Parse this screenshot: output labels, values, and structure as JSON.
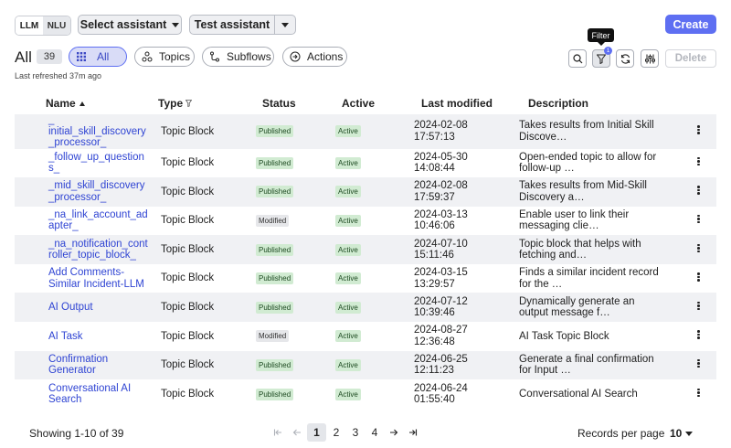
{
  "toolbar": {
    "seg_llm": "LLM",
    "seg_nlu": "NLU",
    "select_assistant": "Select assistant",
    "test_assistant": "Test assistant",
    "create": "Create"
  },
  "filters": {
    "all_label": "All",
    "all_count": "39",
    "pills": [
      "All",
      "Topics",
      "Subflows",
      "Actions"
    ],
    "refreshed": "Last refreshed 37m ago",
    "tooltip": "Filter",
    "filter_badge": "1",
    "delete": "Delete"
  },
  "table": {
    "headers": {
      "name": "Name",
      "type": "Type",
      "status": "Status",
      "active": "Active",
      "modified": "Last modified",
      "description": "Description"
    },
    "rows": [
      {
        "name": "_\ninitial_skill_discovery\n_processor_",
        "type": "Topic Block",
        "status": "Published",
        "active": "Active",
        "date": "2024-02-08",
        "time": "17:57:13",
        "desc1": "Takes results from Initial Skill",
        "desc2": "Discove…"
      },
      {
        "name": "_follow_up_questions_",
        "type": "Topic Block",
        "status": "Published",
        "active": "Active",
        "date": "2024-05-30",
        "time": "14:08:44",
        "desc1": "Open-ended topic to allow for",
        "desc2": "follow-up …"
      },
      {
        "name": "_mid_skill_discovery_processor_",
        "type": "Topic Block",
        "status": "Published",
        "active": "Active",
        "date": "2024-02-08",
        "time": "17:59:37",
        "desc1": "Takes results from Mid-Skill",
        "desc2": "Discovery a…"
      },
      {
        "name": "_na_link_account_adapter_",
        "type": "Topic Block",
        "status": "Modified",
        "active": "Active",
        "date": "2024-03-13",
        "time": "10:46:06",
        "desc1": "Enable user to link their",
        "desc2": "messaging clie…"
      },
      {
        "name": "_na_notification_controller_topic_block_",
        "type": "Topic Block",
        "status": "Published",
        "active": "Active",
        "date": "2024-07-10",
        "time": "15:11:46",
        "desc1": "Topic block that helps with",
        "desc2": "fetching and…"
      },
      {
        "name": "Add Comments-\nSimilar Incident-LLM",
        "type": "Topic Block",
        "status": "Published",
        "active": "Active",
        "date": "2024-03-15",
        "time": "13:29:57",
        "desc1": "Finds a similar incident record",
        "desc2": "for the …"
      },
      {
        "name": "AI Output",
        "type": "Topic Block",
        "status": "Published",
        "active": "Active",
        "date": "2024-07-12",
        "time": "10:39:46",
        "desc1": "Dynamically generate an",
        "desc2": "output message f…"
      },
      {
        "name": "AI Task",
        "type": "Topic Block",
        "status": "Modified",
        "active": "Active",
        "date": "2024-08-27",
        "time": "12:36:48",
        "desc1": "AI Task Topic Block",
        "desc2": ""
      },
      {
        "name": "Confirmation\nGenerator",
        "type": "Topic Block",
        "status": "Published",
        "active": "Active",
        "date": "2024-06-25",
        "time": "12:11:23",
        "desc1": "Generate a final confirmation",
        "desc2": "for Input …"
      },
      {
        "name": "Conversational AI\nSearch",
        "type": "Topic Block",
        "status": "Published",
        "active": "Active",
        "date": "2024-06-24",
        "time": "01:55:40",
        "desc1": "Conversational AI Search",
        "desc2": ""
      }
    ]
  },
  "footer": {
    "showing": "Showing 1-10 of 39",
    "pages": [
      "1",
      "2",
      "3",
      "4"
    ],
    "records_per_page": "Records per page",
    "rpp_value": "10"
  }
}
